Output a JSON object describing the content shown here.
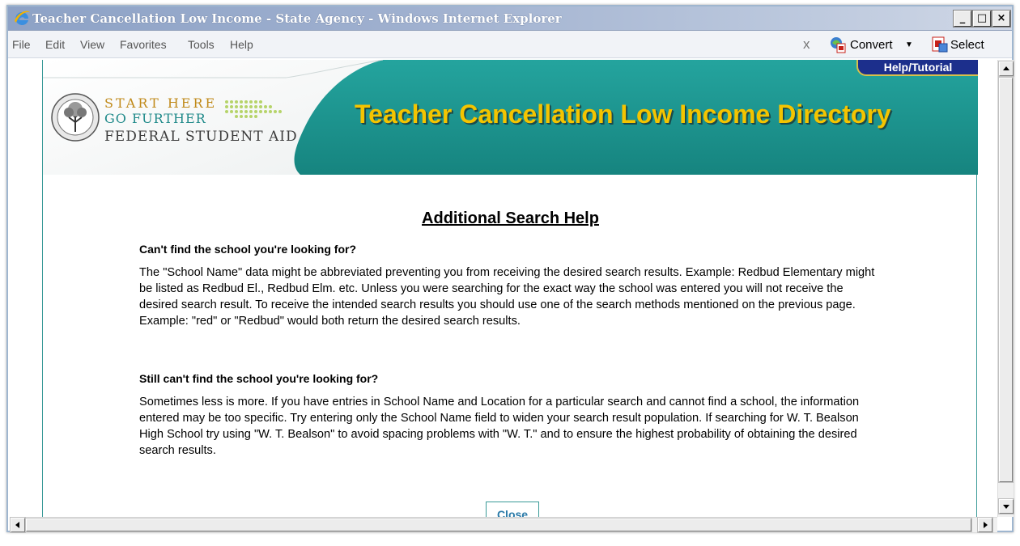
{
  "window": {
    "title": "Teacher Cancellation Low Income - State Agency - Windows Internet Explorer",
    "minimize_label": "_",
    "maximize_label": "□",
    "close_label": "×"
  },
  "menu": {
    "items": [
      "File",
      "Edit",
      "View",
      "Favorites",
      "Tools",
      "Help"
    ],
    "close_x": "x",
    "convert_label": "Convert",
    "select_label": "Select"
  },
  "banner": {
    "help_tab": "Help/Tutorial",
    "logo_line1": "START HERE",
    "logo_line2": "GO FURTHER",
    "logo_line3": "FEDERAL STUDENT AID",
    "title": "Teacher Cancellation Low Income Directory"
  },
  "content": {
    "heading": "Additional Search Help",
    "q1": "Can't find the school you're looking for?",
    "p1": "The \"School Name\" data might be abbreviated preventing you from receiving the desired search results. Example: Redbud Elementary might be listed as Redbud El., Redbud Elm. etc. Unless you were searching for the exact way the school was entered you will not receive the desired search result. To receive the intended search results you should use one of the search methods mentioned on the previous page. Example: \"red\" or \"Redbud\" would both return the desired search results.",
    "q2": "Still can't find the school you're looking for?",
    "p2": "Sometimes less is more. If you have entries in School Name and Location for a particular search and cannot find a school, the information entered may be too specific. Try entering only the School Name field to widen your search result population. If searching for W. T. Bealson High School try using \"W. T. Bealson\" to avoid spacing problems with \"W. T.\" and to ensure the highest probability of obtaining the desired search results.",
    "close_button": "Close"
  },
  "icons": {
    "ie": "ie-logo-icon",
    "convert": "pdf-convert-icon",
    "select": "pdf-select-icon",
    "seal": "department-seal-icon"
  },
  "colors": {
    "teal_banner": "#1f9893",
    "title_yellow": "#f4c400",
    "help_tab_blue": "#1c2f8c"
  }
}
